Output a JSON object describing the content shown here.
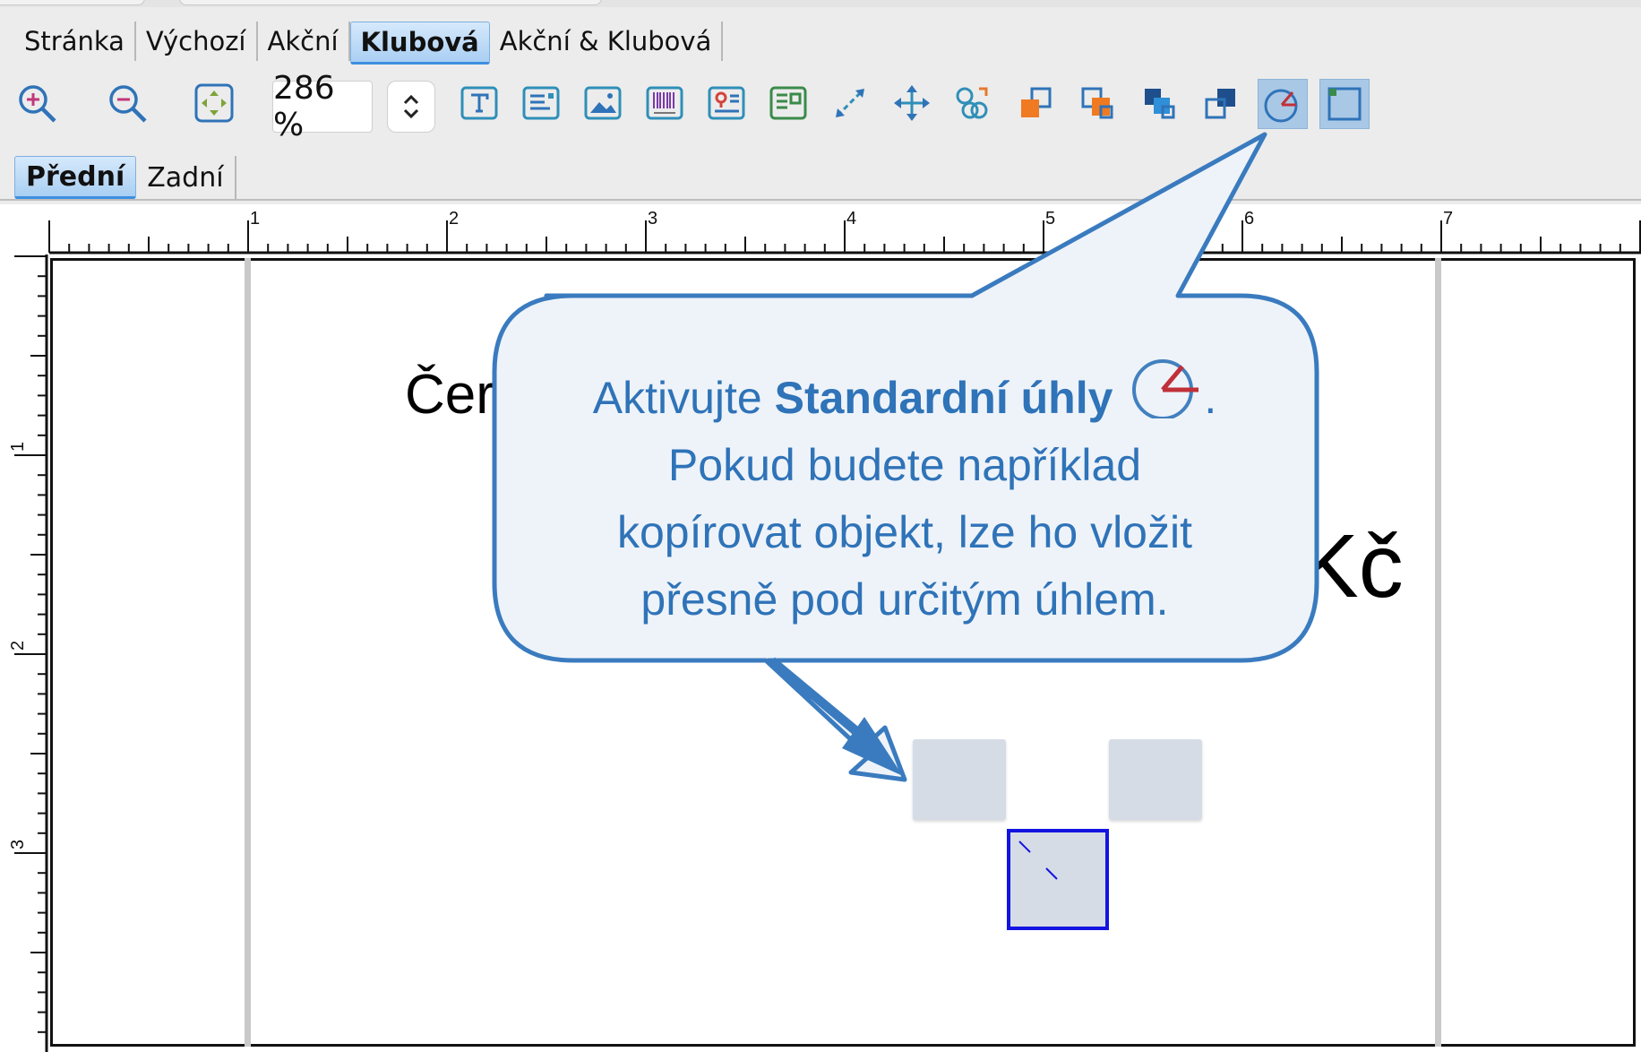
{
  "category_tabs": [
    {
      "label": "Stránka",
      "active": false
    },
    {
      "label": "Výchozí",
      "active": false
    },
    {
      "label": "Akční",
      "active": false
    },
    {
      "label": "Klubová",
      "active": true
    },
    {
      "label": "Akční & Klubová",
      "active": false
    }
  ],
  "toolbar": {
    "zoom_value": "286 %",
    "buttons": [
      "zoom-in-icon",
      "zoom-out-icon",
      "fit-to-window-icon",
      "text-object-icon",
      "paragraph-object-icon",
      "image-object-icon",
      "barcode-object-icon",
      "map-object-icon",
      "table-object-icon",
      "resize-icon",
      "move-icon",
      "group-icon",
      "bring-forward-icon",
      "bring-to-front-icon",
      "send-backward-icon",
      "send-to-back-icon",
      "standard-angles-icon",
      "frame-icon"
    ],
    "pressed": [
      "standard-angles-icon",
      "frame-icon"
    ]
  },
  "side_tabs": [
    {
      "label": "Přední",
      "active": true
    },
    {
      "label": "Zadní",
      "active": false
    }
  ],
  "ruler": {
    "top_labels": [
      "1",
      "2",
      "3",
      "4",
      "5",
      "6",
      "7"
    ],
    "left_labels": [
      "1",
      "2",
      "3"
    ]
  },
  "label_content": {
    "text_top": "Čer",
    "text_right": "Kč"
  },
  "callout": {
    "line1_prefix": "Aktivujte ",
    "line1_bold": "Standardní úhly",
    "line1_suffix": ".",
    "line2": "Pokud budete například",
    "line3": "kopírovat objekt, lze ho vložit",
    "line4": "přesně pod určitým úhlem."
  },
  "colors": {
    "callout_border": "#3a7bbf",
    "callout_fill": "#eef3f9",
    "callout_text": "#2f73b8",
    "selection": "#1414e0",
    "active_tab": "#a9cff3"
  }
}
